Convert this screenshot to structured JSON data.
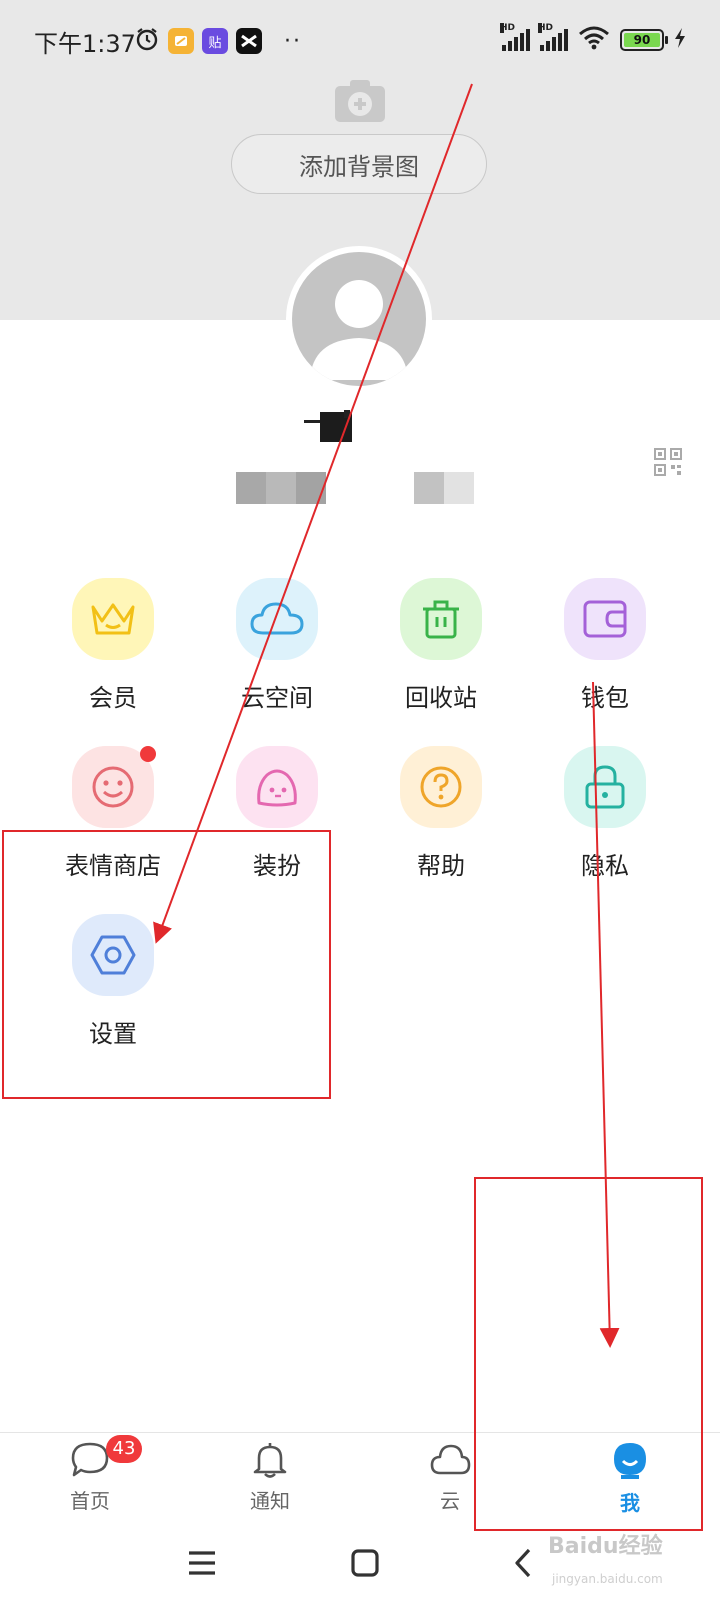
{
  "status_bar": {
    "time": "下午1:37",
    "battery": "90",
    "app_icons": [
      {
        "name": "alarm-icon"
      },
      {
        "name": "notes-app-icon",
        "color": "#f5b335"
      },
      {
        "name": "tieba-app-icon",
        "label": "贴",
        "color": "#6a4be0"
      },
      {
        "name": "capcut-app-icon",
        "color": "#111111"
      }
    ],
    "more": "··"
  },
  "header": {
    "add_background_label": "添加背景图"
  },
  "grid": [
    {
      "name": "vip",
      "label": "会员",
      "icon": "crown-icon",
      "bg": "#fff6b8",
      "color": "#f2c016"
    },
    {
      "name": "cloud-space",
      "label": "云空间",
      "icon": "cloud-icon",
      "bg": "#ddf2fb",
      "color": "#3aa3dd"
    },
    {
      "name": "recycle-bin",
      "label": "回收站",
      "icon": "trash-icon",
      "bg": "#ddf7d6",
      "color": "#39b349"
    },
    {
      "name": "wallet",
      "label": "钱包",
      "icon": "wallet-icon",
      "bg": "#efe3fb",
      "color": "#a461d8"
    },
    {
      "name": "sticker-store",
      "label": "表情商店",
      "icon": "smile-icon",
      "bg": "#fde3e3",
      "color": "#e56b73",
      "has_dot": true
    },
    {
      "name": "dress-up",
      "label": "装扮",
      "icon": "ghost-icon",
      "bg": "#fde2f1",
      "color": "#e468b0"
    },
    {
      "name": "help",
      "label": "帮助",
      "icon": "question-icon",
      "bg": "#fff0d6",
      "color": "#efa52a"
    },
    {
      "name": "privacy",
      "label": "隐私",
      "icon": "lock-icon",
      "bg": "#d9f6f0",
      "color": "#25b1a0"
    },
    {
      "name": "settings",
      "label": "设置",
      "icon": "hexagon-gear-icon",
      "bg": "#dfeafb",
      "color": "#4f7fd9"
    }
  ],
  "bottom_nav": [
    {
      "name": "home",
      "label": "首页",
      "icon": "chat-bubble-icon",
      "badge": "43",
      "active": false
    },
    {
      "name": "notifications",
      "label": "通知",
      "icon": "bell-icon",
      "active": false
    },
    {
      "name": "cloud",
      "label": "云",
      "icon": "cloud-outline-icon",
      "active": false
    },
    {
      "name": "me",
      "label": "我",
      "icon": "me-avatar-icon",
      "active": true
    }
  ],
  "colors": {
    "accent": "#1a8fe3",
    "badge": "#f0393b",
    "annotation": "#e0282b"
  },
  "watermark": {
    "brand": "Baidu经验",
    "url": "jingyan.baidu.com"
  }
}
